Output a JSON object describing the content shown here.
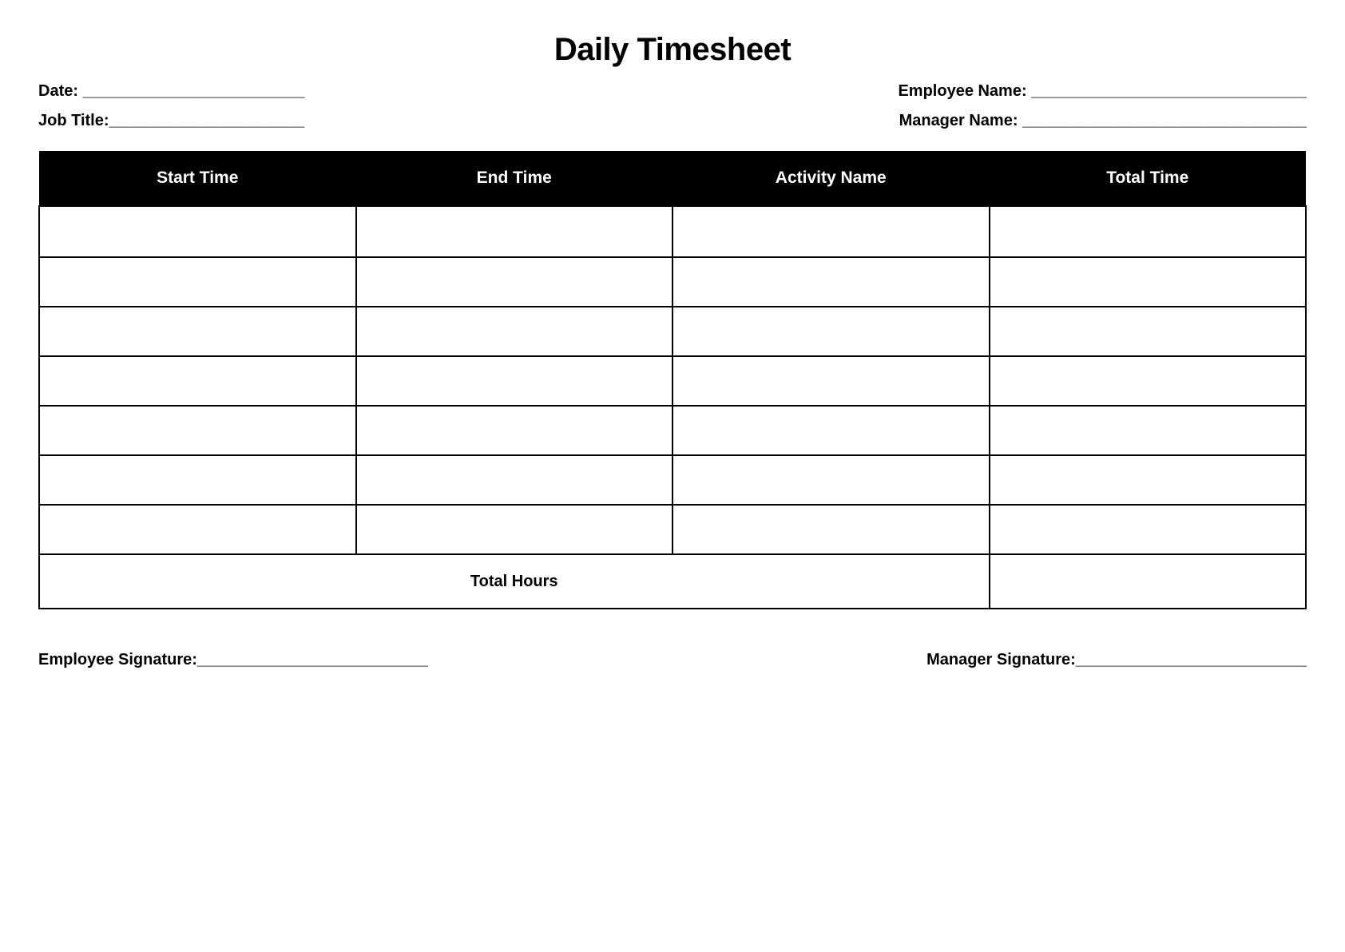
{
  "title": "Daily Timesheet",
  "fields": {
    "date_label": "Date: _________________________",
    "employee_name_label": "Employee Name: _______________________________",
    "job_title_label": "Job Title:______________________",
    "manager_name_label": "Manager Name: ________________________________"
  },
  "table": {
    "headers": [
      "Start Time",
      "End Time",
      "Activity Name",
      "Total Time"
    ],
    "rows": [
      [
        "",
        "",
        "",
        ""
      ],
      [
        "",
        "",
        "",
        ""
      ],
      [
        "",
        "",
        "",
        ""
      ],
      [
        "",
        "",
        "",
        ""
      ],
      [
        "",
        "",
        "",
        ""
      ],
      [
        "",
        "",
        "",
        ""
      ],
      [
        "",
        "",
        "",
        ""
      ]
    ],
    "total_label": "Total Hours",
    "total_value": ""
  },
  "signatures": {
    "employee_label": "Employee Signature:__________________________",
    "manager_label": "Manager Signature:__________________________"
  }
}
